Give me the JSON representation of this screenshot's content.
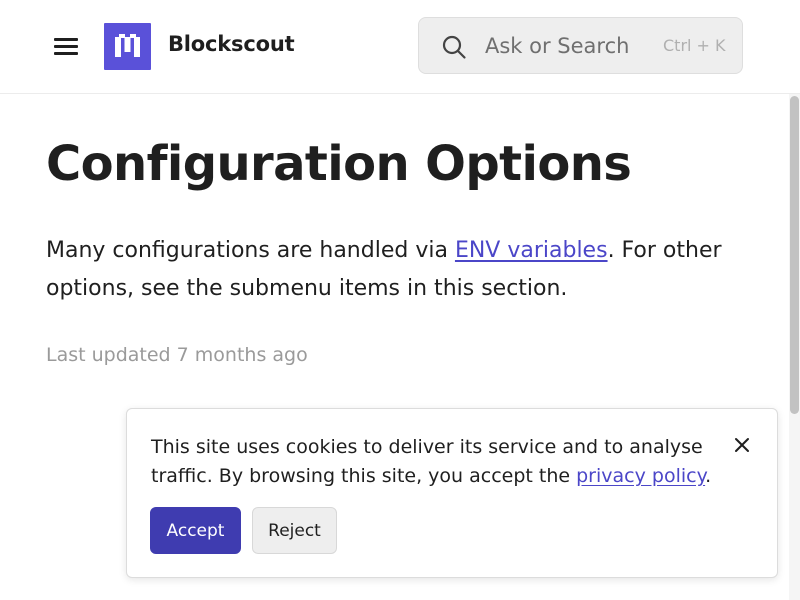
{
  "header": {
    "brand": "Blockscout",
    "search": {
      "placeholder": "Ask or Search",
      "shortcut": "Ctrl + K"
    }
  },
  "page": {
    "title": "Configuration Options",
    "intro_before": "Many configurations are handled via ",
    "intro_link": "ENV variables",
    "intro_after": ". For other options, see the submenu items in this section.",
    "last_updated": "Last updated 7 months ago"
  },
  "cookie_banner": {
    "text_before": "This site uses cookies to deliver its service and to analyse traffic. By browsing this site, you accept the ",
    "link": "privacy policy",
    "text_after": ".",
    "accept_label": "Accept",
    "reject_label": "Reject"
  },
  "colors": {
    "accent": "#3f3cb0",
    "link": "#4b46c8",
    "logo": "#5a51d9"
  }
}
